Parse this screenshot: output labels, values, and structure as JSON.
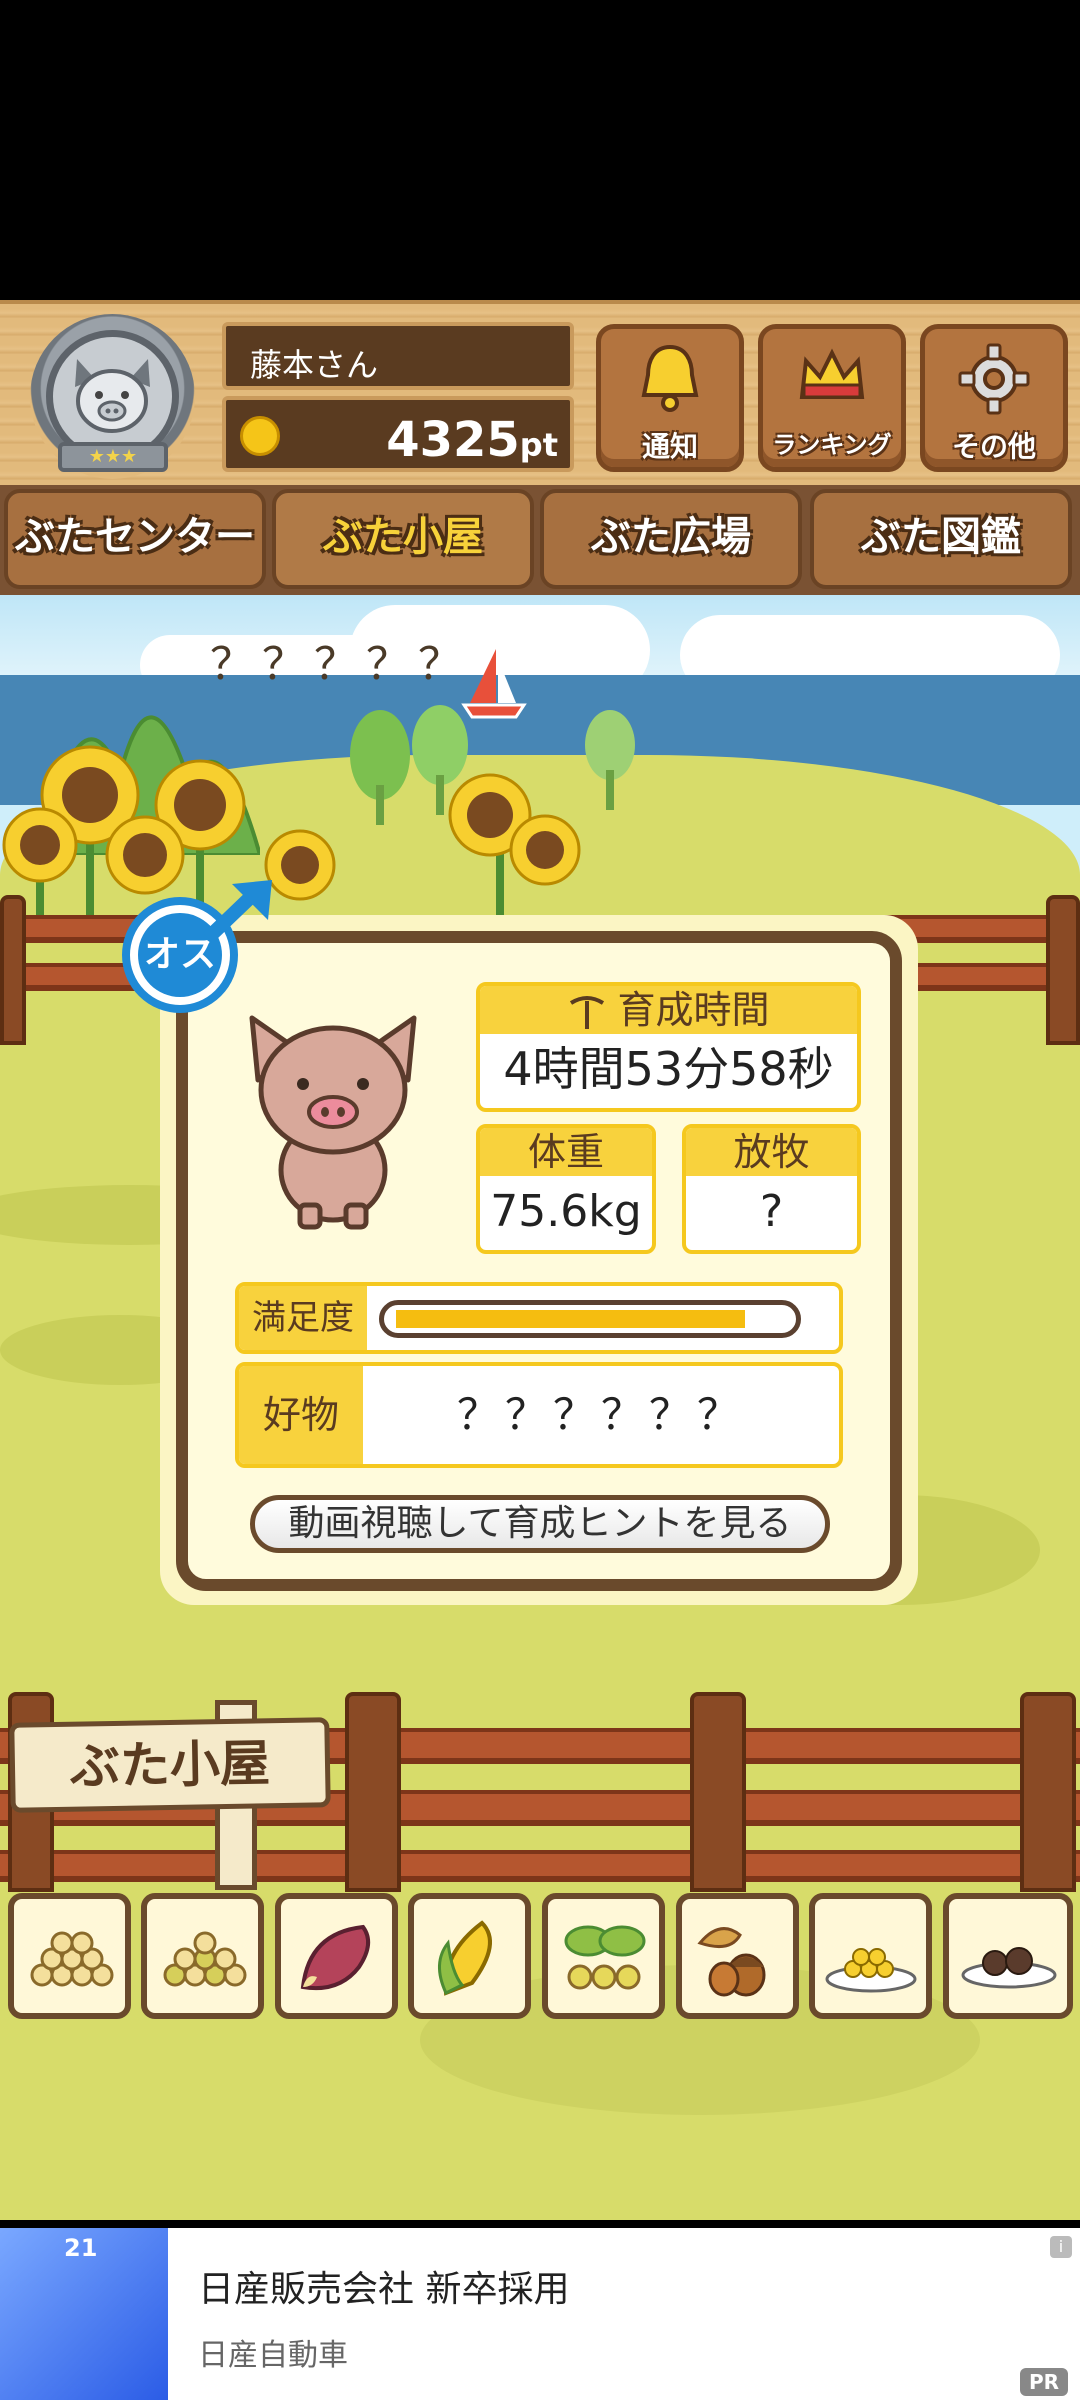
{
  "header": {
    "user_name": "藤本さん",
    "points": "4325",
    "points_unit": "pt",
    "buttons": [
      {
        "label": "通知",
        "icon": "bell-icon"
      },
      {
        "label": "ランキング",
        "icon": "crown-icon"
      },
      {
        "label": "その他",
        "icon": "gear-icon"
      }
    ]
  },
  "tabs": [
    {
      "label": "ぶたセンター",
      "active": false
    },
    {
      "label": "ぶた小屋",
      "active": true
    },
    {
      "label": "ぶた広場",
      "active": false
    },
    {
      "label": "ぶた図鑑",
      "active": false
    }
  ],
  "pig": {
    "gender_label": "オス",
    "name": "？？？？？",
    "growth_time_label": "育成時間",
    "growth_time_value": "4時間53分58秒",
    "weight_label": "体重",
    "weight_value": "75.6kg",
    "grazing_label": "放牧",
    "grazing_value": "?",
    "satisfaction_label": "満足度",
    "satisfaction_level": 0.9,
    "favorite_label": "好物",
    "favorite_value": "？？？？？？",
    "hint_button": "動画視聴して育成ヒントを見る"
  },
  "sign_label": "ぶた小屋",
  "foods": [
    {
      "icon": "beans-icon"
    },
    {
      "icon": "mixed-beans-icon"
    },
    {
      "icon": "sweet-potato-icon"
    },
    {
      "icon": "corn-icon"
    },
    {
      "icon": "leaf-beans-icon"
    },
    {
      "icon": "acorn-icon"
    },
    {
      "icon": "corn-plate-icon"
    },
    {
      "icon": "truffle-plate-icon"
    }
  ],
  "ad": {
    "title": "日産販売会社 新卒採用",
    "sponsor": "日産自動車",
    "badge": "PR",
    "info": "i",
    "image_text": "21"
  }
}
